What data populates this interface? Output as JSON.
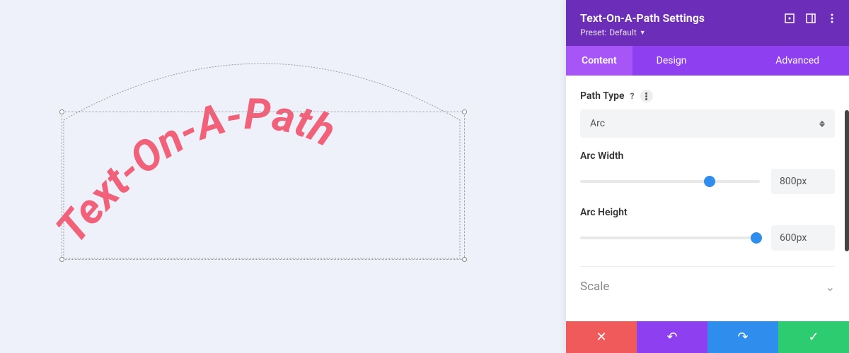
{
  "canvas": {
    "text": "Text-On-A-Path"
  },
  "panel": {
    "title": "Text-On-A-Path Settings",
    "preset_label": "Preset:",
    "preset_value": "Default"
  },
  "tabs": {
    "content": "Content",
    "design": "Design",
    "advanced": "Advanced"
  },
  "fields": {
    "path_type_label": "Path Type",
    "path_type_value": "Arc",
    "arc_width_label": "Arc Width",
    "arc_width_value": "800px",
    "arc_height_label": "Arc Height",
    "arc_height_value": "600px"
  },
  "accordion": {
    "scale": "Scale"
  },
  "sliders": {
    "arc_width_pos": 72,
    "arc_height_pos": 98
  }
}
